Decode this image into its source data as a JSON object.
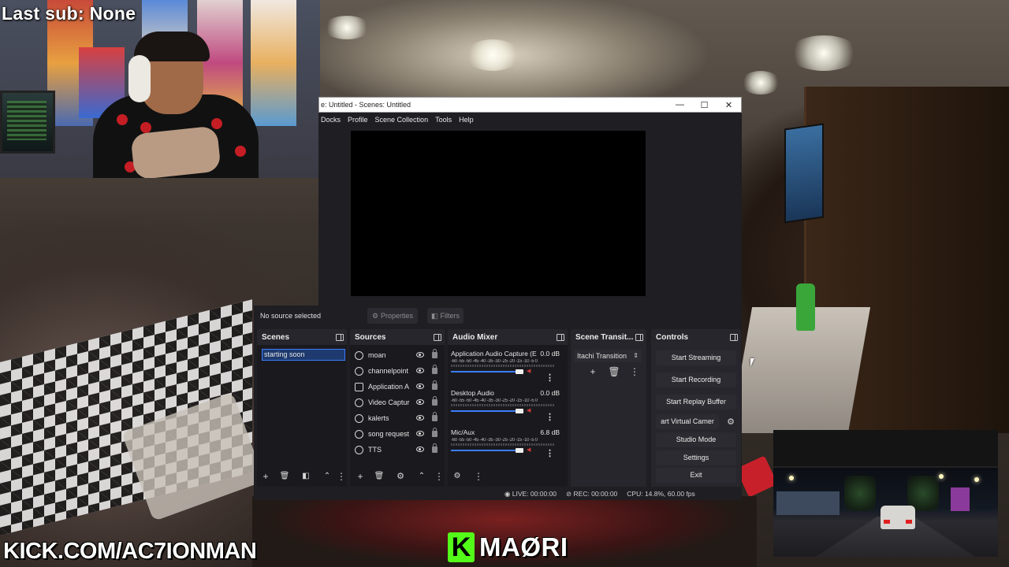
{
  "overlays": {
    "last_sub": "Last sub: None",
    "kick_url": "KICK.COM/AC7IONMAN",
    "brand_k": "K",
    "brand_name": "MAØRI"
  },
  "window": {
    "title": "e: Untitled - Scenes: Untitled",
    "minimize": "—",
    "maximize": "☐",
    "close": "✕"
  },
  "menu": [
    "Docks",
    "Profile",
    "Scene Collection",
    "Tools",
    "Help"
  ],
  "source_toolbar": {
    "no_source": "No source selected",
    "properties_label": "Properties",
    "filters_label": "Filters"
  },
  "scenes": {
    "title": "Scenes",
    "items": [
      "starting soon"
    ]
  },
  "sources": {
    "title": "Sources",
    "items": [
      {
        "name": "moan",
        "icon": "audio-icon"
      },
      {
        "name": "channelpoint",
        "icon": "audio-icon"
      },
      {
        "name": "Application A",
        "icon": "window-icon"
      },
      {
        "name": "Video Captur",
        "icon": "camera-icon"
      },
      {
        "name": "kalerts",
        "icon": "browser-icon"
      },
      {
        "name": "song request",
        "icon": "browser-icon"
      },
      {
        "name": "TTS",
        "icon": "browser-icon"
      }
    ]
  },
  "audio_mixer": {
    "title": "Audio Mixer",
    "scale": "-60 -55 -50 -45 -40 -35 -30 -25 -20 -15 -10 -5 0",
    "tracks": [
      {
        "name": "Application Audio Capture (E",
        "level": "0.0 dB"
      },
      {
        "name": "Desktop Audio",
        "level": "0.0 dB"
      },
      {
        "name": "Mic/Aux",
        "level": "6.8 dB"
      }
    ]
  },
  "transitions": {
    "title": "Scene Transit...",
    "selected": "Itachi Transition"
  },
  "controls": {
    "title": "Controls",
    "start_streaming": "Start Streaming",
    "start_recording": "Start Recording",
    "start_replay": "Start Replay Buffer",
    "virtual_camera": "art Virtual Camer",
    "studio_mode": "Studio Mode",
    "settings": "Settings",
    "exit": "Exit"
  },
  "status": {
    "live": "LIVE: 00:00:00",
    "rec": "REC: 00:00:00",
    "cpu": "CPU: 14.8%, 60.00 fps"
  },
  "colors": {
    "accent": "#3d7cff",
    "kick_green": "#53fc18",
    "panel": "#27262c",
    "window_bg": "#1f1e22"
  }
}
